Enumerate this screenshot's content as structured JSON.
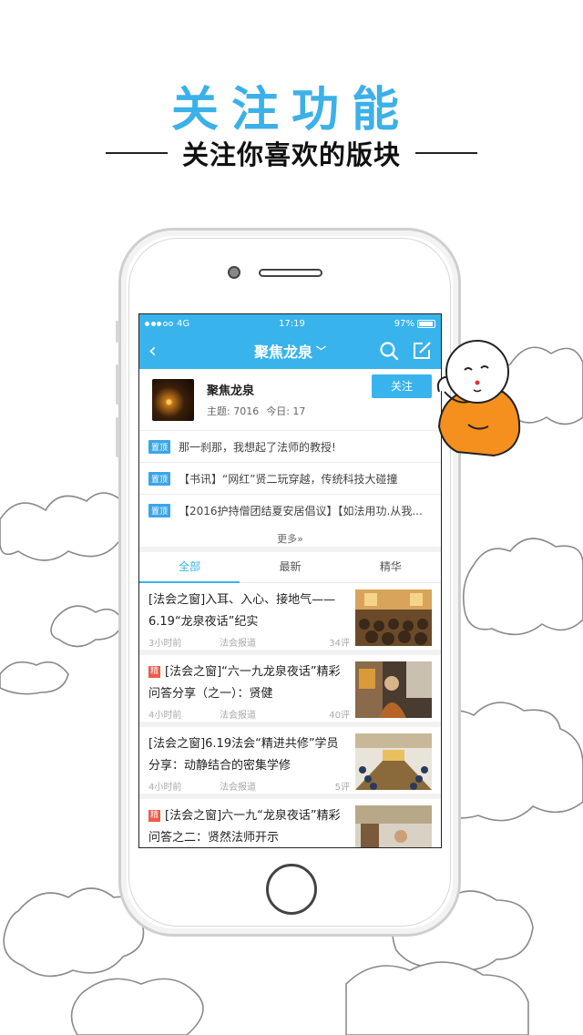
{
  "headline": "关注功能",
  "subline": "关注你喜欢的版块",
  "status_bar": {
    "carrier": "4G",
    "time": "17:19",
    "battery": "97%"
  },
  "nav": {
    "back_icon": "chevron-left-icon",
    "title": "聚焦龙泉",
    "search_icon": "search-icon",
    "edit_icon": "edit-icon"
  },
  "forum": {
    "name": "聚焦龙泉",
    "topics": "主题: 7016",
    "today": "今日: 17",
    "follow_label": "关注"
  },
  "pinned": [
    {
      "tag": "置顶",
      "text": "那一刹那，我想起了法师的教授!"
    },
    {
      "tag": "置顶",
      "text": "【书讯】“网红”贤二玩穿越，传统科技大碰撞"
    },
    {
      "tag": "置顶",
      "text": "【2016护持僧团结夏安居倡议】【如法用功.从我..."
    }
  ],
  "more_label": "更多»",
  "tabs": [
    {
      "label": "全部",
      "active": true
    },
    {
      "label": "最新",
      "active": false
    },
    {
      "label": "精华",
      "active": false
    }
  ],
  "posts": [
    {
      "badge": "",
      "title": "[法会之窗]入耳、入心、接地气——6.19“龙泉夜话”纪实",
      "time": "3小时前",
      "source": "法会报道",
      "comments": "34评"
    },
    {
      "badge": "精",
      "title": "[法会之窗]“六一九龙泉夜话”精彩问答分享（之一）：贤健",
      "time": "4小时前",
      "source": "法会报道",
      "comments": "40评"
    },
    {
      "badge": "",
      "title": "[法会之窗]6.19法会“精进共修”学员分享：动静结合的密集学修",
      "time": "4小时前",
      "source": "法会报道",
      "comments": "5评"
    },
    {
      "badge": "精",
      "title": "[法会之窗]六一九“龙泉夜话”精彩问答之二：贤然法师开示",
      "time": "",
      "source": "",
      "comments": ""
    }
  ],
  "colors": {
    "accent": "#38b3ec",
    "headline": "#3cb0e8",
    "jing_badge": "#f05a4a"
  }
}
